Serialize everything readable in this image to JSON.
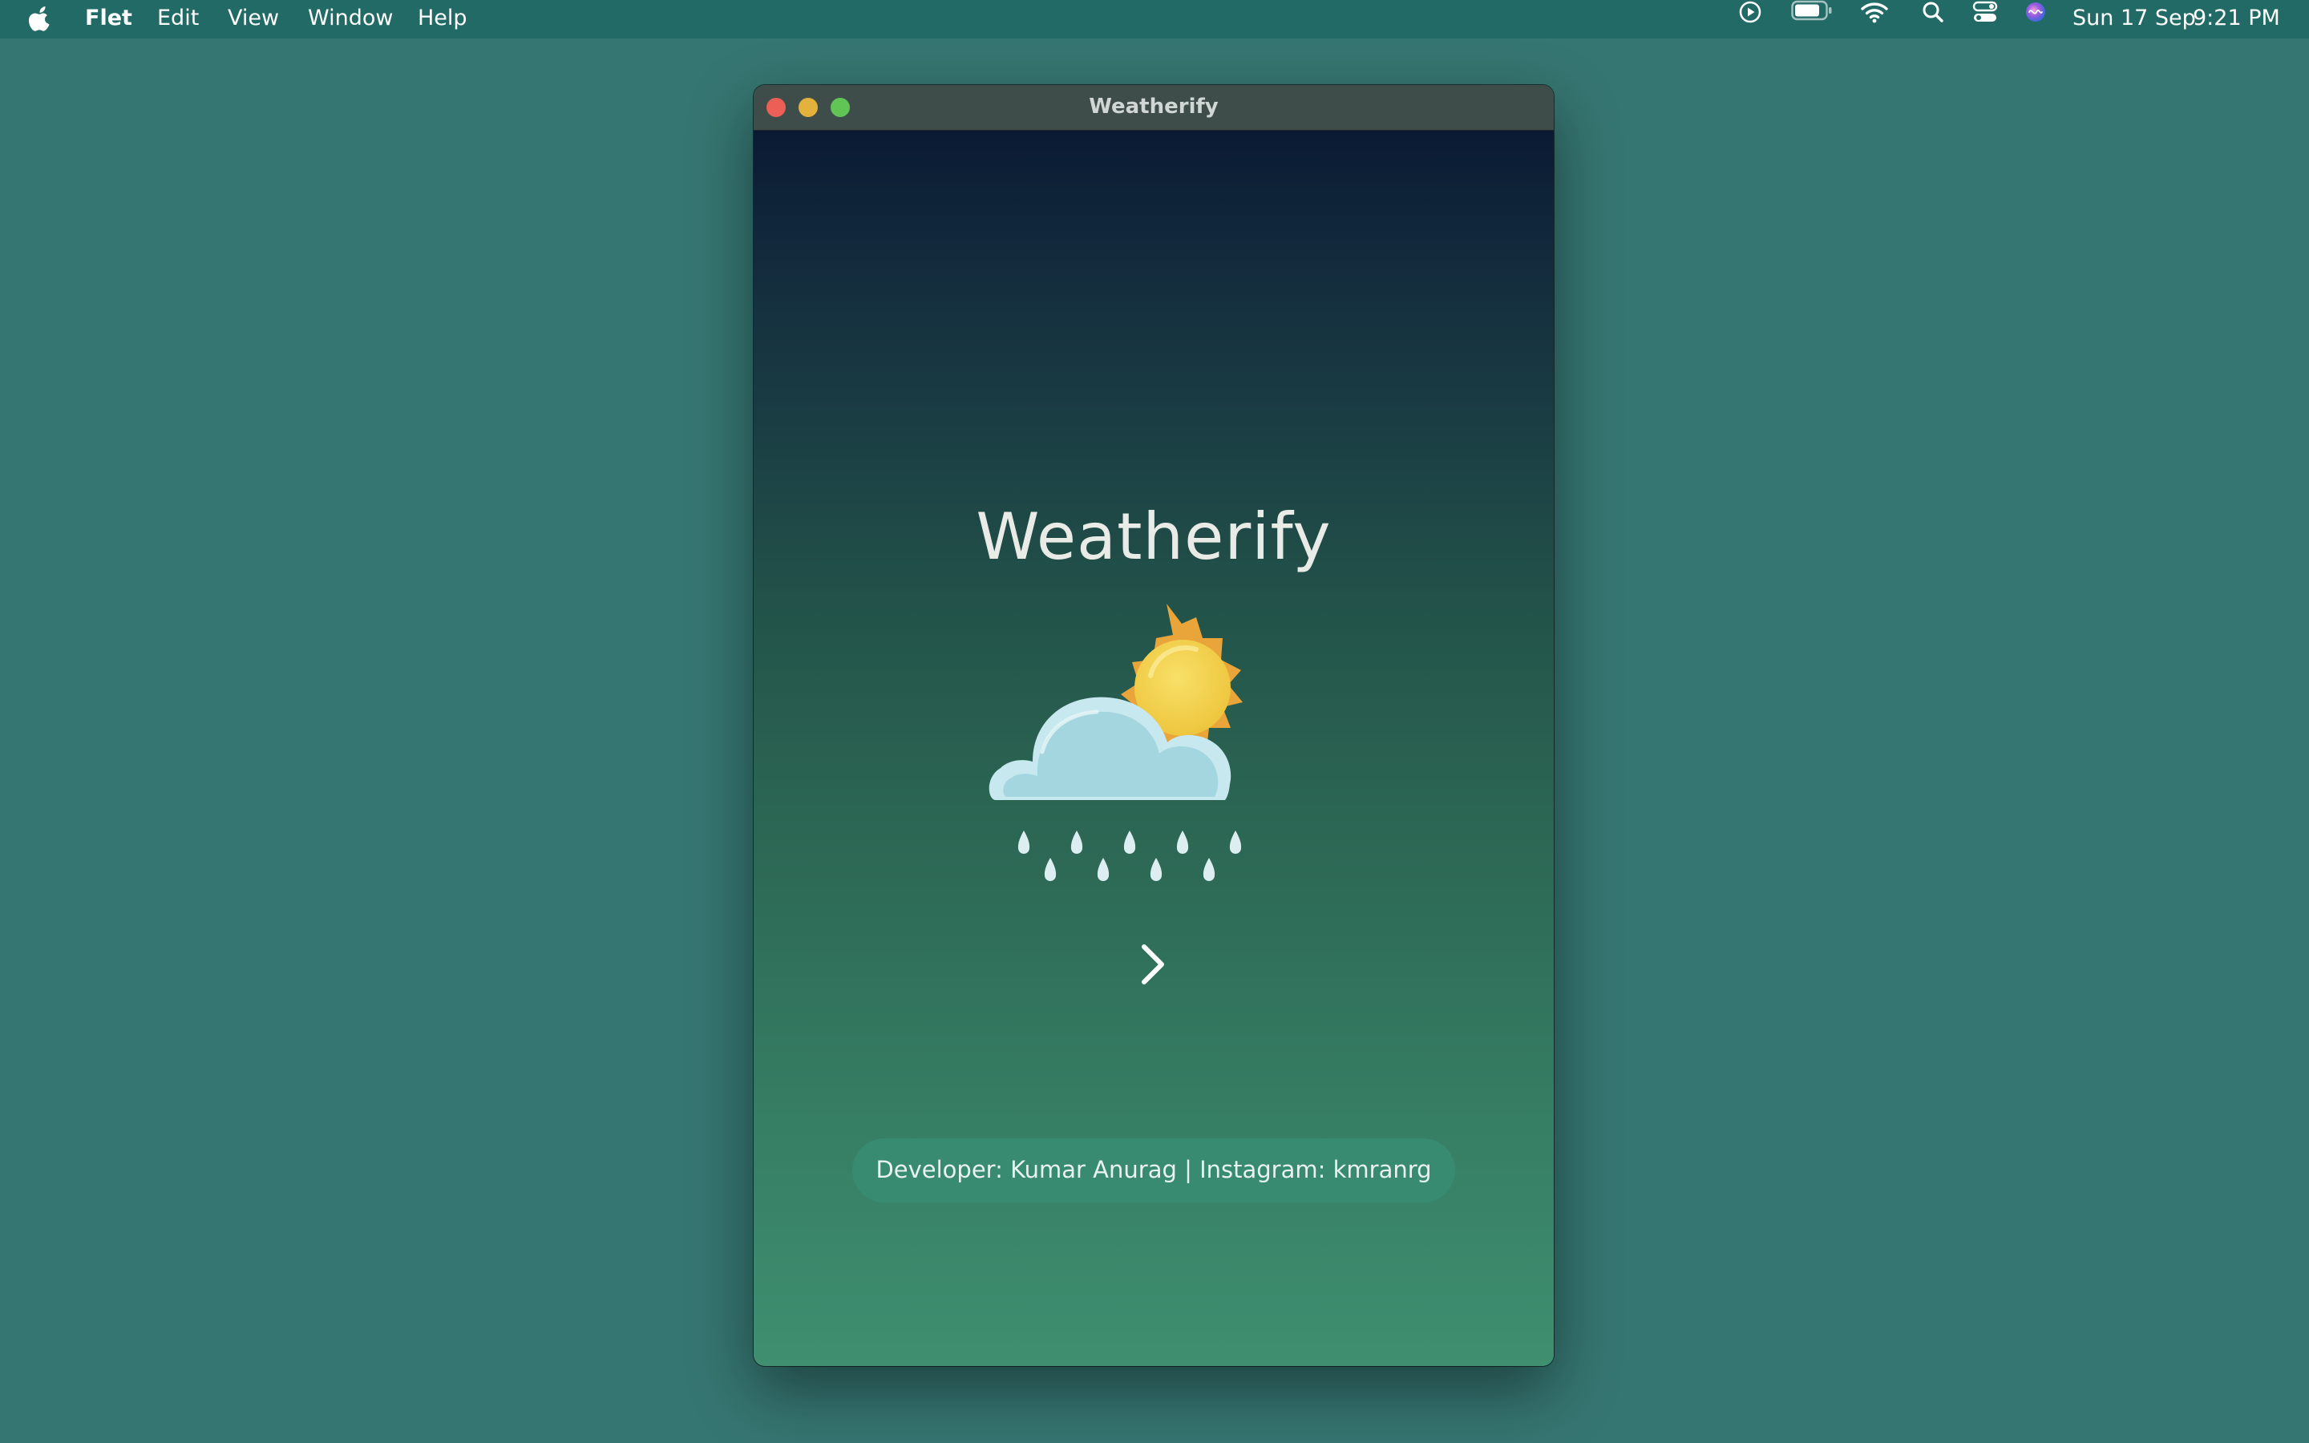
{
  "menubar": {
    "app_name": "Flet",
    "menus": [
      "Edit",
      "View",
      "Window",
      "Help"
    ],
    "date": "Sun 17 Sep",
    "time": "9:21 PM",
    "status_icons": [
      "play-circle-icon",
      "battery-icon",
      "wifi-icon",
      "search-icon",
      "control-center-icon",
      "siri-icon"
    ]
  },
  "window": {
    "title": "Weatherify",
    "controls": [
      "close",
      "minimize",
      "zoom"
    ]
  },
  "app": {
    "heading": "Weatherify",
    "illustration": "sun-cloud-rain-icon",
    "next_icon": "chevron-right-icon",
    "credit": "Developer: Kumar Anurag | Instagram: kmranrg"
  },
  "colors": {
    "desktop": "#367672",
    "menubar": "#226a66",
    "gradient_top": "#0a1a33",
    "gradient_bottom": "#3f8f70",
    "pill": "#388a70",
    "sun": "#f3d24e",
    "sun_rays": "#e9a53a",
    "cloud": "#a3d6df"
  }
}
